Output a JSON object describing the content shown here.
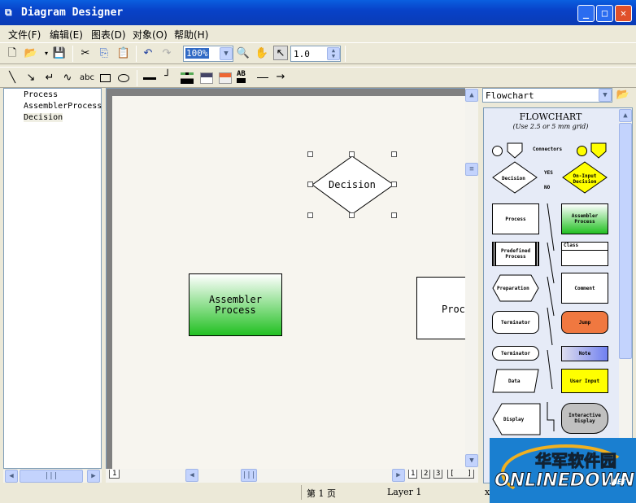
{
  "window": {
    "title": "Diagram Designer"
  },
  "menu": [
    "文件(F)",
    "编辑(E)",
    "图表(D)",
    "对象(O)",
    "帮助(H)"
  ],
  "toolbar": {
    "zoom": "100%",
    "line_width": "1.0",
    "text_tool": "abc",
    "text_color_tool": "AB"
  },
  "tree": [
    "Process",
    "AssemblerProcess",
    "Decision"
  ],
  "canvas": {
    "decision": "Decision",
    "assembler": "Assembler\nProcess",
    "process": "Proc",
    "page_tab": "1",
    "page_tabs": [
      "1",
      "2",
      "3",
      "[   ]"
    ]
  },
  "palette": {
    "selector": "Flowchart",
    "title": "FLOWCHART",
    "subtitle": "(Use 2.5 or 5 mm grid)",
    "items": {
      "connectors": "Connectors",
      "decision": "Decision",
      "yes": "YES",
      "no": "NO",
      "on_input": "On-Input Decision",
      "process": "Process",
      "assembler": "Assembler Process",
      "predefined": "Predefined Process",
      "class": "Class",
      "preparation": "Preparation",
      "comment": "Comment",
      "terminator1": "Terminator",
      "jump": "Jump",
      "terminator2": "Terminator",
      "note": "Note",
      "data": "Data",
      "user_input": "User Input",
      "display": "Display",
      "interactive": "Interactive Display"
    }
  },
  "status": {
    "page": "第 1 页",
    "layer": "Layer 1",
    "coord": "x"
  },
  "watermark": {
    "cn": "华军软件园",
    "en": "ONLINEDOWN",
    "net": ".NET"
  },
  "colors": {
    "titlebar": "#0a4fd6",
    "assembler_green": "#22c022",
    "jump": "#f07840",
    "note": "#7080f0",
    "user_input": "#ffff00"
  }
}
